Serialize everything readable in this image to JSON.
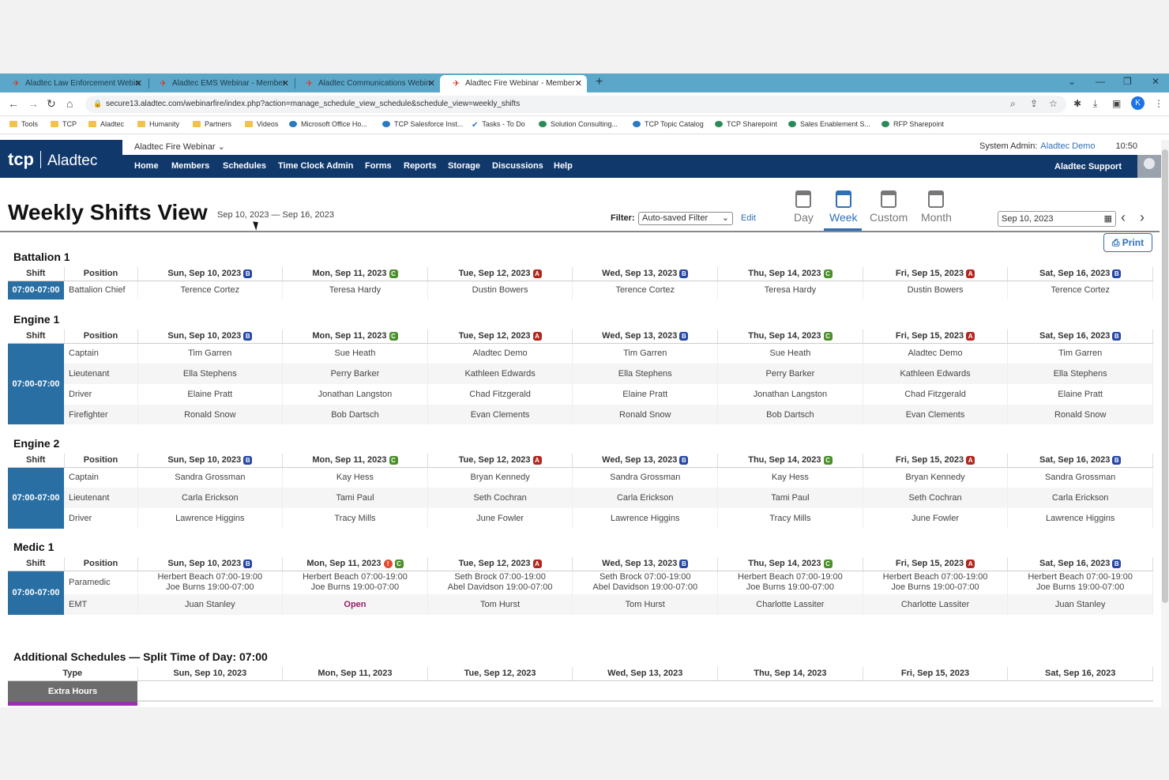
{
  "tabs": [
    {
      "label": "Aladtec Law Enforcement Webin"
    },
    {
      "label": "Aladtec EMS Webinar - Member"
    },
    {
      "label": "Aladtec Communications Webin"
    },
    {
      "label": "Aladtec Fire Webinar - Member"
    }
  ],
  "url": "secure13.aladtec.com/webinarfire/index.php?action=manage_schedule_view_schedule&schedule_view=weekly_shifts",
  "bookmarks": [
    {
      "label": "Tools",
      "icon": "folder-icon"
    },
    {
      "label": "TCP",
      "icon": "folder-icon"
    },
    {
      "label": "Aladtec",
      "icon": "folder-icon"
    },
    {
      "label": "Humanity",
      "icon": "folder-icon"
    },
    {
      "label": "Partners",
      "icon": "folder-icon"
    },
    {
      "label": "Videos",
      "icon": "folder-icon"
    },
    {
      "label": "Microsoft Office Ho...",
      "icon": "office-icon"
    },
    {
      "label": "TCP Salesforce Inst...",
      "icon": "cloud-icon"
    },
    {
      "label": "Tasks - To Do",
      "icon": "check-icon"
    },
    {
      "label": "Solution Consulting...",
      "icon": "sharepoint-icon"
    },
    {
      "label": "TCP Topic Catalog",
      "icon": "cloud-icon"
    },
    {
      "label": "TCP Sharepoint",
      "icon": "sharepoint-icon"
    },
    {
      "label": "Sales Enablement S...",
      "icon": "sharepoint-icon"
    },
    {
      "label": "RFP Sharepoint",
      "icon": "sharepoint-icon"
    }
  ],
  "app": {
    "logo_mark": "tcp",
    "logo_name": "Aladtec",
    "org": "Aladtec Fire Webinar",
    "role": "System Admin:",
    "user": "Aladtec Demo",
    "time": "10:50",
    "support": "Aladtec Support",
    "menu": [
      "Home",
      "Members",
      "Schedules",
      "Time Clock Admin",
      "Forms",
      "Reports",
      "Storage",
      "Discussions",
      "Help"
    ]
  },
  "page": {
    "title": "Weekly Shifts View",
    "range": "Sep 10, 2023 — Sep 16, 2023",
    "filter_label": "Filter:",
    "filter_value": "Auto-saved Filter",
    "edit": "Edit",
    "views": [
      "Day",
      "Week",
      "Custom",
      "Month"
    ],
    "active_view": "Week",
    "date": "Sep 10, 2023",
    "print": "Print"
  },
  "headers": {
    "shift": "Shift",
    "position": "Position",
    "type": "Type",
    "days": [
      "Sun, Sep 10, 2023",
      "Mon, Sep 11, 2023",
      "Tue, Sep 12, 2023",
      "Wed, Sep 13, 2023",
      "Thu, Sep 14, 2023",
      "Fri, Sep 15, 2023",
      "Sat, Sep 16, 2023"
    ],
    "badges": [
      "B",
      "C",
      "A",
      "B",
      "C",
      "A",
      "B"
    ]
  },
  "sections": [
    {
      "title": "Battalion 1",
      "shift": "07:00-07:00",
      "rows": [
        {
          "position": "Battalion Chief",
          "cells": [
            "Terence Cortez",
            "Teresa Hardy",
            "Dustin Bowers",
            "Terence Cortez",
            "Teresa Hardy",
            "Dustin Bowers",
            "Terence Cortez"
          ]
        }
      ]
    },
    {
      "title": "Engine 1",
      "shift": "07:00-07:00",
      "rows": [
        {
          "position": "Captain",
          "cells": [
            "Tim Garren",
            "Sue Heath",
            "Aladtec Demo",
            "Tim Garren",
            "Sue Heath",
            "Aladtec Demo",
            "Tim Garren"
          ]
        },
        {
          "position": "Lieutenant",
          "cells": [
            "Ella Stephens",
            "Perry Barker",
            "Kathleen Edwards",
            "Ella Stephens",
            "Perry Barker",
            "Kathleen Edwards",
            "Ella Stephens"
          ]
        },
        {
          "position": "Driver",
          "cells": [
            "Elaine Pratt",
            "Jonathan Langston",
            "Chad Fitzgerald",
            "Elaine Pratt",
            "Jonathan Langston",
            "Chad Fitzgerald",
            "Elaine Pratt"
          ]
        },
        {
          "position": "Firefighter",
          "cells": [
            "Ronald Snow",
            "Bob Dartsch",
            "Evan Clements",
            "Ronald Snow",
            "Bob Dartsch",
            "Evan Clements",
            "Ronald Snow"
          ]
        }
      ]
    },
    {
      "title": "Engine 2",
      "shift": "07:00-07:00",
      "rows": [
        {
          "position": "Captain",
          "cells": [
            "Sandra Grossman",
            "Kay Hess",
            "Bryan Kennedy",
            "Sandra Grossman",
            "Kay Hess",
            "Bryan Kennedy",
            "Sandra Grossman"
          ]
        },
        {
          "position": "Lieutenant",
          "cells": [
            "Carla Erickson",
            "Tami Paul",
            "Seth Cochran",
            "Carla Erickson",
            "Tami Paul",
            "Seth Cochran",
            "Carla Erickson"
          ]
        },
        {
          "position": "Driver",
          "cells": [
            "Lawrence Higgins",
            "Tracy Mills",
            "June Fowler",
            "Lawrence Higgins",
            "Tracy Mills",
            "June Fowler",
            "Lawrence Higgins"
          ]
        }
      ]
    },
    {
      "title": "Medic 1",
      "shift": "07:00-07:00",
      "rows": [
        {
          "position": "Paramedic",
          "cells": [
            [
              "Herbert Beach 07:00-19:00",
              "Joe Burns 19:00-07:00"
            ],
            [
              "Herbert Beach 07:00-19:00",
              "Joe Burns 19:00-07:00"
            ],
            [
              "Seth Brock 07:00-19:00",
              "Abel Davidson 19:00-07:00"
            ],
            [
              "Seth Brock 07:00-19:00",
              "Abel Davidson 19:00-07:00"
            ],
            [
              "Herbert Beach 07:00-19:00",
              "Joe Burns 19:00-07:00"
            ],
            [
              "Herbert Beach 07:00-19:00",
              "Joe Burns 19:00-07:00"
            ],
            [
              "Herbert Beach 07:00-19:00",
              "Joe Burns 19:00-07:00"
            ]
          ]
        },
        {
          "position": "EMT",
          "cells": [
            "Juan Stanley",
            "Open",
            "Tom Hurst",
            "Tom Hurst",
            "Charlotte Lassiter",
            "Charlotte Lassiter",
            "Juan Stanley"
          ]
        }
      ]
    }
  ],
  "additional": {
    "title": "Additional Schedules — Split Time of Day: 07:00",
    "days": [
      "Sun, Sep 10, 2023",
      "Mon, Sep 11, 2023",
      "Tue, Sep 12, 2023",
      "Wed, Sep 13, 2023",
      "Thu, Sep 14, 2023",
      "Fri, Sep 15, 2023",
      "Sat, Sep 16, 2023"
    ],
    "row": "Extra Hours"
  },
  "colors": {
    "brand": "#10386b",
    "shift": "#2a6fa3",
    "link": "#2f6fb6",
    "open": "#9b1c6b"
  }
}
